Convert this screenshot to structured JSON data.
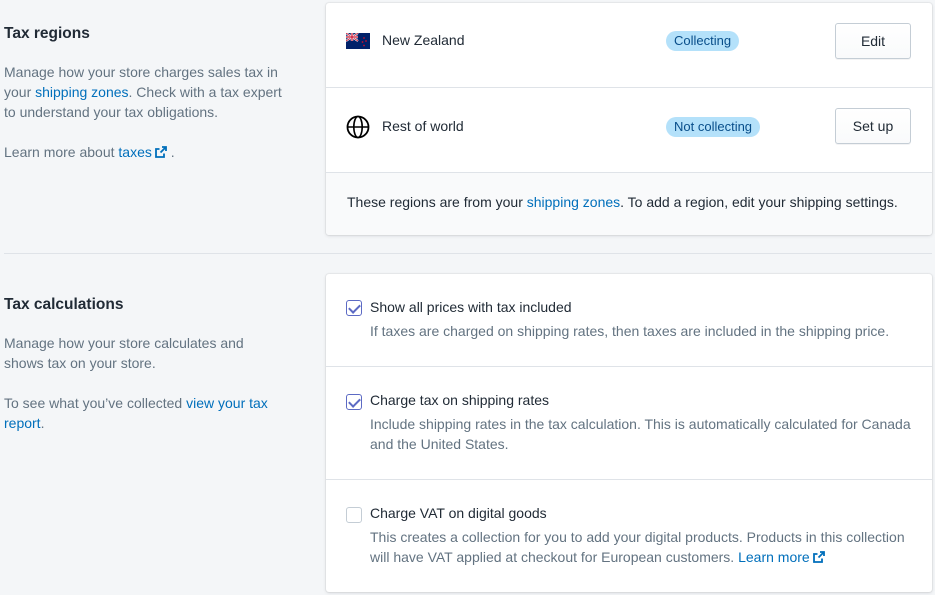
{
  "tax_regions": {
    "title": "Tax regions",
    "desc_1": "Manage how your store charges sales tax in your ",
    "desc_link": "shipping zones",
    "desc_2": ". Check with a tax expert to understand your tax obligations.",
    "learn_prefix": "Learn more about ",
    "learn_link": "taxes",
    "learn_suffix": " .",
    "regions": [
      {
        "name": "New Zealand",
        "status": "Collecting",
        "action": "Edit",
        "icon": "new-zealand-flag-icon"
      },
      {
        "name": "Rest of world",
        "status": "Not collecting",
        "action": "Set up",
        "icon": "globe-icon"
      }
    ],
    "footer_1": "These regions are from your ",
    "footer_link": "shipping zones",
    "footer_2": ". To add a region, edit your shipping settings."
  },
  "tax_calculations": {
    "title": "Tax calculations",
    "desc": "Manage how your store calculates and shows tax on your store.",
    "report_prefix": "To see what you’ve collected ",
    "report_link": "view your tax report",
    "report_suffix": ".",
    "options": [
      {
        "label": "Show all prices with tax included",
        "checked": true,
        "help": "If taxes are charged on shipping rates, then taxes are included in the shipping price."
      },
      {
        "label": "Charge tax on shipping rates",
        "checked": true,
        "help": "Include shipping rates in the tax calculation. This is automatically calculated for Canada and the United States."
      },
      {
        "label": "Charge VAT on digital goods",
        "checked": false,
        "help": "This creates a collection for you to add your digital products. Products in this collection will have VAT applied at checkout for European customers. ",
        "help_link": "Learn more"
      }
    ]
  },
  "colors": {
    "link": "#006fbb",
    "badge_bg": "#b4e1fa",
    "checkbox_accent": "#5c6ac4"
  }
}
